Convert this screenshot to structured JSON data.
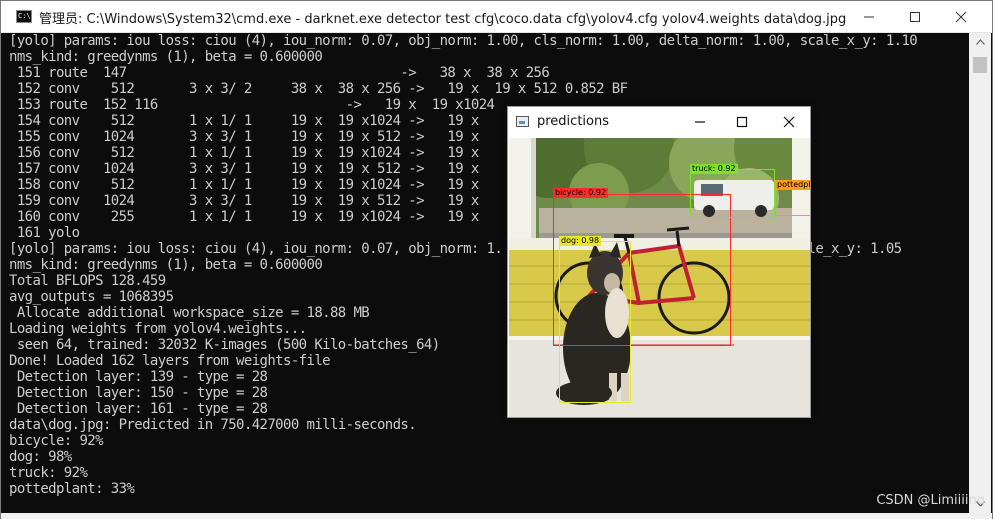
{
  "window": {
    "title": "管理员: C:\\Windows\\System32\\cmd.exe - darknet.exe  detector test cfg\\coco.data cfg\\yolov4.cfg yolov4.weights data\\dog.jpg",
    "icon": "cmd-icon",
    "icon_text": "C:\\",
    "controls": [
      "minimize-icon",
      "maximize-icon",
      "close-icon"
    ]
  },
  "console_lines": [
    "[yolo] params: iou loss: ciou (4), iou_norm: 0.07, obj_norm: 1.00, cls_norm: 1.00, delta_norm: 1.00, scale_x_y: 1.10",
    "nms_kind: greedynms (1), beta = 0.600000",
    " 151 route  147                                   ->   38 x  38 x 256",
    " 152 conv    512       3 x 3/ 2     38 x  38 x 256 ->   19 x  19 x 512 0.852 BF",
    " 153 route  152 116                        ->   19 x  19 x1024",
    " 154 conv    512       1 x 1/ 1     19 x  19 x1024 ->   19 x",
    " 155 conv   1024       3 x 3/ 1     19 x  19 x 512 ->   19 x",
    " 156 conv    512       1 x 1/ 1     19 x  19 x1024 ->   19 x",
    " 157 conv   1024       3 x 3/ 1     19 x  19 x 512 ->   19 x",
    " 158 conv    512       1 x 1/ 1     19 x  19 x1024 ->   19 x",
    " 159 conv   1024       3 x 3/ 1     19 x  19 x 512 ->   19 x",
    " 160 conv    255       1 x 1/ 1     19 x  19 x1024 ->   19 x",
    " 161 yolo",
    "[yolo] params: iou loss: ciou (4), iou_norm: 0.07, obj_norm: 1.                                    scale_x_y: 1.05",
    "nms_kind: greedynms (1), beta = 0.600000",
    "Total BFLOPS 128.459",
    "avg_outputs = 1068395",
    " Allocate additional workspace_size = 18.88 MB",
    "Loading weights from yolov4.weights...",
    " seen 64, trained: 32032 K-images (500 Kilo-batches_64)",
    "Done! Loaded 162 layers from weights-file",
    " Detection layer: 139 - type = 28",
    " Detection layer: 150 - type = 28",
    " Detection layer: 161 - type = 28",
    "data\\dog.jpg: Predicted in 750.427000 milli-seconds.",
    "bicycle: 92%",
    "dog: 98%",
    "truck: 92%",
    "pottedplant: 33%"
  ],
  "predictions_window": {
    "title": "predictions",
    "controls": [
      "minimize-icon",
      "maximize-icon",
      "close-icon"
    ],
    "detections": [
      {
        "label": "bicycle: 0.92",
        "color": "#ff2a2a"
      },
      {
        "label": "dog: 0.98",
        "color": "#e8e82a"
      },
      {
        "label": "truck: 0.92",
        "color": "#7fe02a"
      },
      {
        "label": "pottedplant",
        "color": "#ff9a1a"
      }
    ]
  },
  "watermark": "CSDN @Limiiiing",
  "colors": {
    "console_bg": "#0c0c0c",
    "console_text": "#cccccc",
    "titlebar_bg": "#ffffff"
  }
}
